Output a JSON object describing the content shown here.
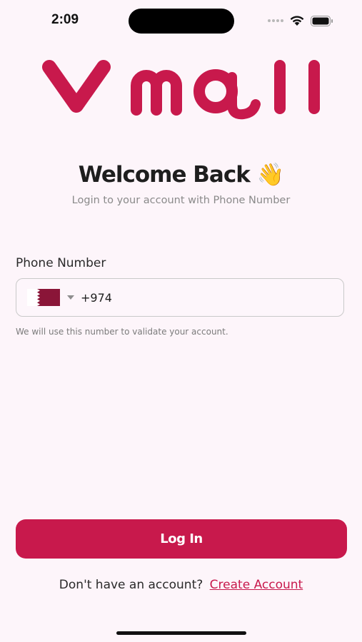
{
  "status_bar": {
    "time": "2:09",
    "wifi_icon": "wifi-icon",
    "battery_icon": "battery-icon"
  },
  "brand": {
    "logo_text": "V Mall",
    "color": "#c8194c"
  },
  "welcome": {
    "title": "Welcome Back",
    "emoji": "👋",
    "subtitle": "Login to your account with Phone Number"
  },
  "phone": {
    "label": "Phone Number",
    "country_flag": "qatar-flag",
    "dial_code": "+974",
    "helper": "We will use this number to validate your account."
  },
  "login": {
    "button_label": "Log In"
  },
  "signup": {
    "prompt": "Don't have an account?",
    "link_label": "Create Account"
  },
  "colors": {
    "background": "#fdf5fa",
    "accent": "#c8194c"
  }
}
